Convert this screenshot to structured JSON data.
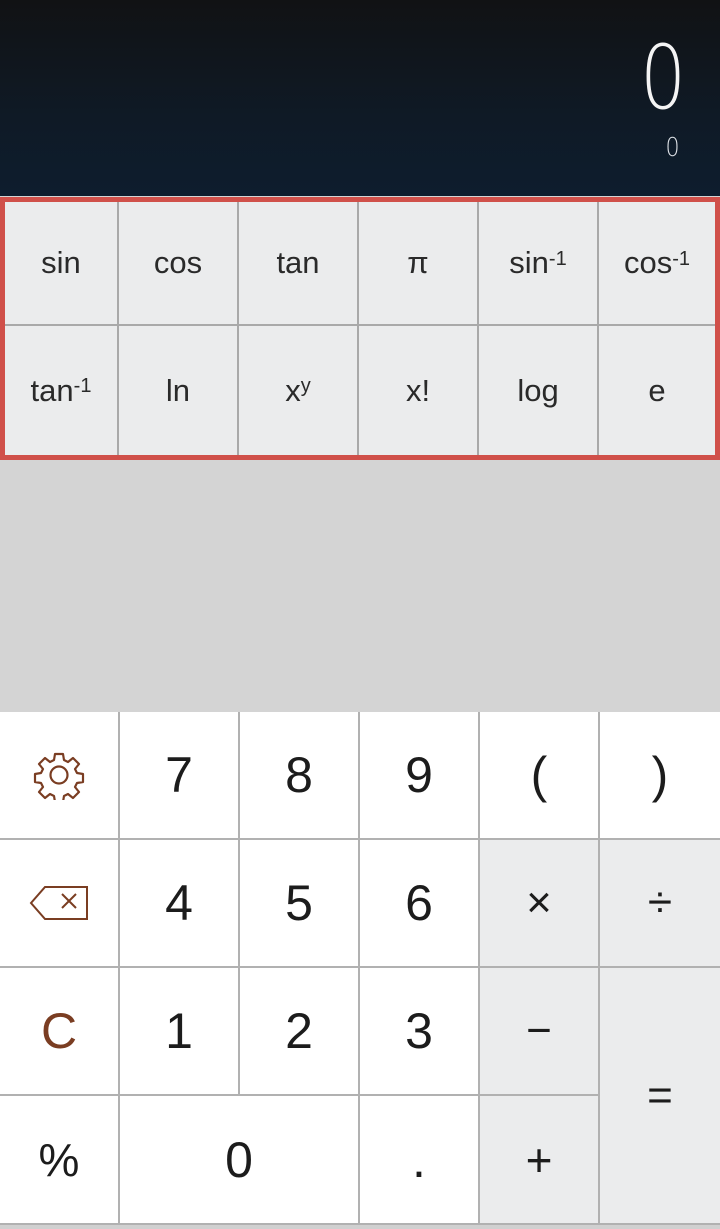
{
  "display": {
    "main_value": "0",
    "preview_value": "0"
  },
  "scientific_panel": {
    "highlight_color": "#d0504a",
    "keys": [
      {
        "label": "sin",
        "sup": ""
      },
      {
        "label": "cos",
        "sup": ""
      },
      {
        "label": "tan",
        "sup": ""
      },
      {
        "label": "π",
        "sup": ""
      },
      {
        "label": "sin",
        "sup": "-1"
      },
      {
        "label": "cos",
        "sup": "-1"
      },
      {
        "label": "tan",
        "sup": "-1"
      },
      {
        "label": "ln",
        "sup": ""
      },
      {
        "label": "x",
        "sup": "y"
      },
      {
        "label": "x!",
        "sup": ""
      },
      {
        "label": "log",
        "sup": ""
      },
      {
        "label": "e",
        "sup": ""
      }
    ]
  },
  "keypad": {
    "settings_icon": "gear-icon",
    "backspace_icon": "backspace-icon",
    "accent_color": "#7a3d22",
    "keys": {
      "seven": "7",
      "eight": "8",
      "nine": "9",
      "open_paren": "(",
      "close_paren": ")",
      "four": "4",
      "five": "5",
      "six": "6",
      "multiply": "×",
      "divide": "÷",
      "clear": "C",
      "one": "1",
      "two": "2",
      "three": "3",
      "minus": "−",
      "equals": "=",
      "percent": "%",
      "zero": "0",
      "decimal": ".",
      "plus": "+"
    }
  }
}
